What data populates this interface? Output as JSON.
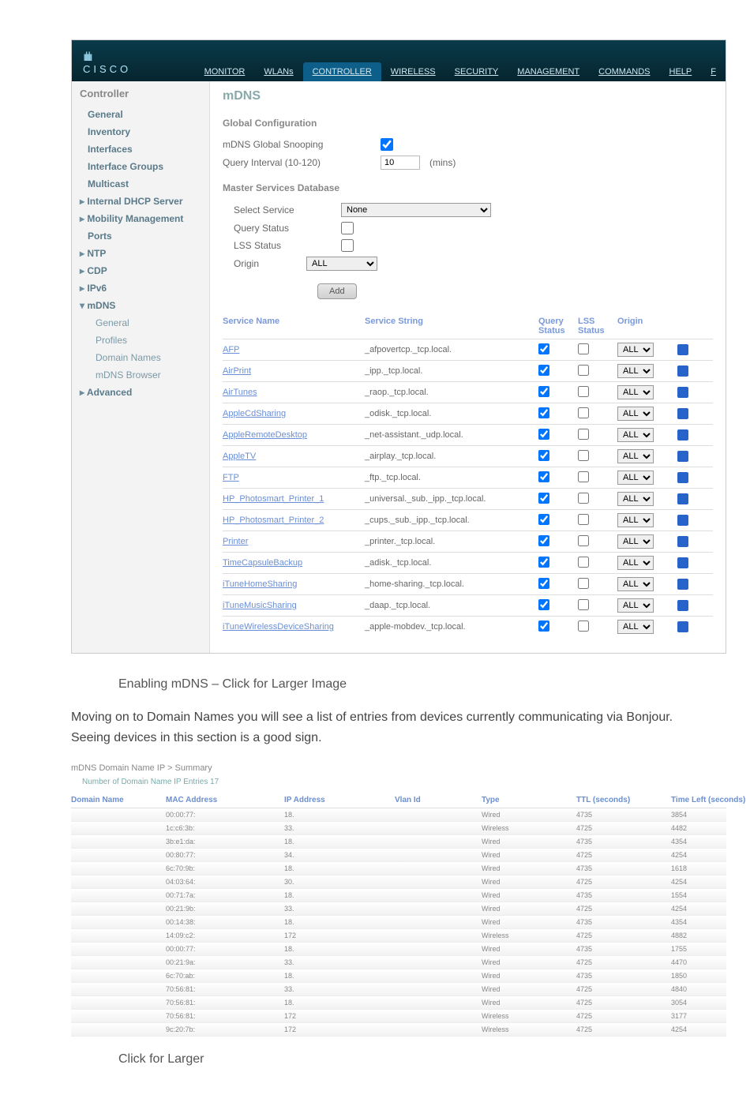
{
  "topbar": {
    "tabs": [
      "MONITOR",
      "WLANs",
      "CONTROLLER",
      "WIRELESS",
      "SECURITY",
      "MANAGEMENT",
      "COMMANDS",
      "HELP",
      "F"
    ]
  },
  "sidebar": {
    "title": "Controller",
    "items": [
      {
        "label": "General",
        "b": true
      },
      {
        "label": "Inventory",
        "b": true
      },
      {
        "label": "Interfaces",
        "b": true
      },
      {
        "label": "Interface Groups",
        "b": true
      },
      {
        "label": "Multicast",
        "b": true
      },
      {
        "label": "Internal DHCP Server",
        "b": true,
        "lead": true
      },
      {
        "label": "Mobility Management",
        "b": true,
        "lead": true
      },
      {
        "label": "Ports",
        "b": true
      },
      {
        "label": "NTP",
        "b": true,
        "lead": true
      },
      {
        "label": "CDP",
        "b": true,
        "lead": true
      },
      {
        "label": "IPv6",
        "b": true,
        "lead": true
      },
      {
        "label": "mDNS",
        "b": true,
        "leadd": true,
        "subs": [
          "General",
          "Profiles",
          "Domain Names",
          "mDNS Browser"
        ]
      },
      {
        "label": "Advanced",
        "b": true,
        "lead": true
      }
    ]
  },
  "main": {
    "title": "mDNS",
    "global_conf": "Global Configuration",
    "snoop_label": "mDNS Global Snooping",
    "snoop_on": true,
    "qi_label": "Query Interval (10-120)",
    "qi_value": "10",
    "qi_unit": "(mins)",
    "msd": "Master Services Database",
    "sel_svc_label": "Select Service",
    "sel_svc_value": "None",
    "qstatus_label": "Query Status",
    "lss_label": "LSS Status",
    "origin_label": "Origin",
    "origin_value": "ALL",
    "add_btn": "Add",
    "cols": {
      "name": "Service Name",
      "str": "Service String",
      "q": "Query\nStatus",
      "lss": "LSS\nStatus",
      "orig": "Origin"
    },
    "services": [
      {
        "name": "AFP",
        "str": "_afpovertcp._tcp.local.",
        "q": true,
        "lss": false,
        "orig": "ALL"
      },
      {
        "name": "AirPrint",
        "str": "_ipp._tcp.local.",
        "q": true,
        "lss": false,
        "orig": "ALL"
      },
      {
        "name": "AirTunes",
        "str": "_raop._tcp.local.",
        "q": true,
        "lss": false,
        "orig": "ALL"
      },
      {
        "name": "AppleCdSharing",
        "str": "_odisk._tcp.local.",
        "q": true,
        "lss": false,
        "orig": "ALL"
      },
      {
        "name": "AppleRemoteDesktop",
        "str": "_net-assistant._udp.local.",
        "q": true,
        "lss": false,
        "orig": "ALL"
      },
      {
        "name": "AppleTV",
        "str": "_airplay._tcp.local.",
        "q": true,
        "lss": false,
        "orig": "ALL"
      },
      {
        "name": "FTP",
        "str": "_ftp._tcp.local.",
        "q": true,
        "lss": false,
        "orig": "ALL"
      },
      {
        "name": "HP_Photosmart_Printer_1",
        "str": "_universal._sub._ipp._tcp.local.",
        "q": true,
        "lss": false,
        "orig": "ALL"
      },
      {
        "name": "HP_Photosmart_Printer_2",
        "str": "_cups._sub._ipp._tcp.local.",
        "q": true,
        "lss": false,
        "orig": "ALL"
      },
      {
        "name": "Printer",
        "str": "_printer._tcp.local.",
        "q": true,
        "lss": false,
        "orig": "ALL"
      },
      {
        "name": "TimeCapsuleBackup",
        "str": "_adisk._tcp.local.",
        "q": true,
        "lss": false,
        "orig": "ALL"
      },
      {
        "name": "iTuneHomeSharing",
        "str": "_home-sharing._tcp.local.",
        "q": true,
        "lss": false,
        "orig": "ALL"
      },
      {
        "name": "iTuneMusicSharing",
        "str": "_daap._tcp.local.",
        "q": true,
        "lss": false,
        "orig": "ALL"
      },
      {
        "name": "iTuneWirelessDeviceSharing",
        "str": "_apple-mobdev._tcp.local.",
        "q": true,
        "lss": false,
        "orig": "ALL"
      }
    ]
  },
  "caption1": "Enabling mDNS – Click for Larger Image",
  "para": "Moving on to Domain Names you will see a list of entries from devices currently communicating via Bonjour. Seeing devices in this section is a good sign.",
  "shot2": {
    "title": "mDNS Domain Name IP > Summary",
    "sub": "Number of Domain Name IP Entries  17",
    "cols": [
      "Domain Name",
      "MAC Address",
      "IP Address",
      "Vlan Id",
      "Type",
      "TTL (seconds)",
      "Time Left (seconds)"
    ],
    "rows": [
      [
        "",
        "00:00:77:",
        "18.",
        "",
        "Wired",
        "4735",
        "3854"
      ],
      [
        "",
        "1c:c6:3b:",
        "33.",
        "",
        "Wireless",
        "4725",
        "4482"
      ],
      [
        "",
        "3b:e1:da:",
        "18.",
        "",
        "Wired",
        "4735",
        "4354"
      ],
      [
        "",
        "00:80:77:",
        "34.",
        "",
        "Wired",
        "4725",
        "4254"
      ],
      [
        "",
        "6c:70:9b:",
        "18.",
        "",
        "Wired",
        "4735",
        "1618"
      ],
      [
        "",
        "04:03:64:",
        "30.",
        "",
        "Wired",
        "4725",
        "4254"
      ],
      [
        "",
        "00:71:7a:",
        "18.",
        "",
        "Wired",
        "4735",
        "1554"
      ],
      [
        "",
        "00:21:9b:",
        "33.",
        "",
        "Wired",
        "4725",
        "4254"
      ],
      [
        "",
        "00:14:38:",
        "18.",
        "",
        "Wired",
        "4735",
        "4354"
      ],
      [
        "",
        "14:09:c2:",
        "172",
        "",
        "Wireless",
        "4725",
        "4882"
      ],
      [
        "",
        "00:00:77:",
        "18.",
        "",
        "Wired",
        "4735",
        "1755"
      ],
      [
        "",
        "00:21:9a:",
        "33.",
        "",
        "Wired",
        "4725",
        "4470"
      ],
      [
        "",
        "6c:70:ab:",
        "18.",
        "",
        "Wired",
        "4735",
        "1850"
      ],
      [
        "",
        "70:56:81:",
        "33.",
        "",
        "Wired",
        "4725",
        "4840"
      ],
      [
        "",
        "70:56:81:",
        "18.",
        "",
        "Wired",
        "4725",
        "3054"
      ],
      [
        "",
        "70:56:81:",
        "172",
        "",
        "Wireless",
        "4725",
        "3177"
      ],
      [
        "",
        "9c:20:7b:",
        "172",
        "",
        "Wireless",
        "4725",
        "4254"
      ]
    ]
  },
  "caption2": "Click for Larger"
}
